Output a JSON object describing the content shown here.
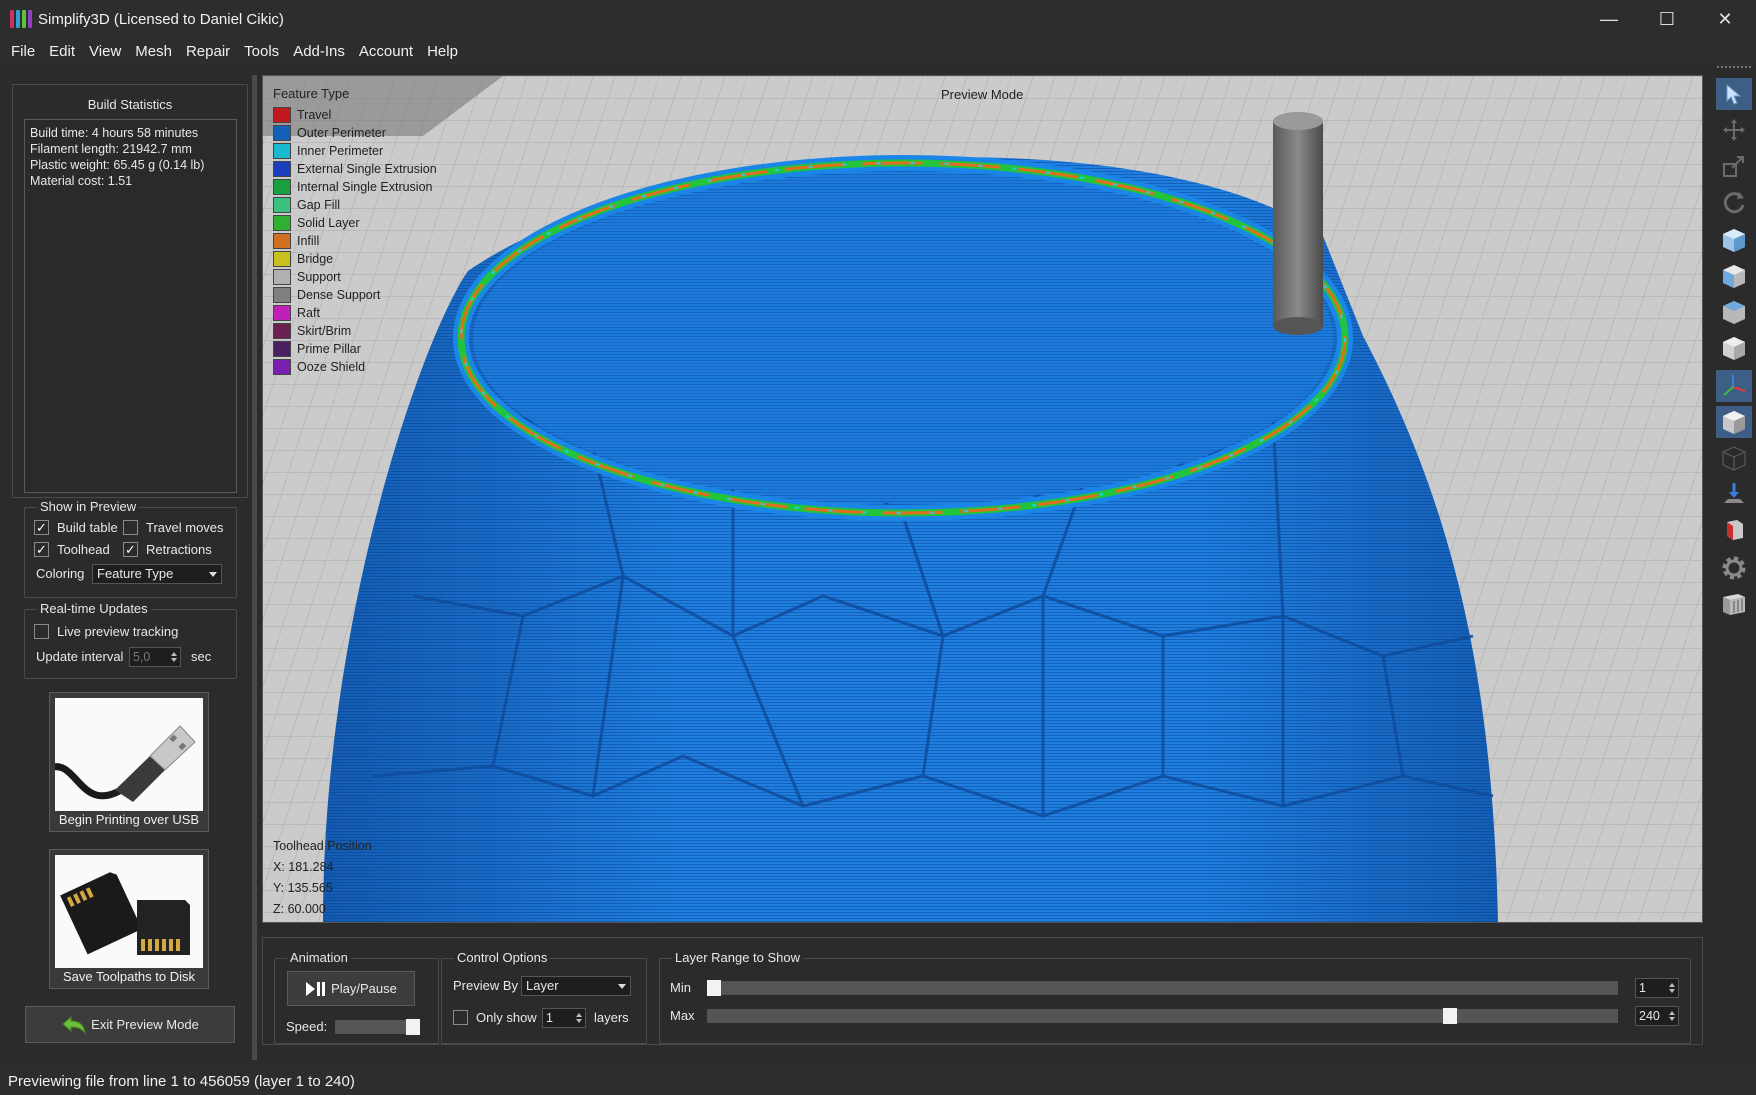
{
  "window": {
    "title": "Simplify3D (Licensed to Daniel Cikic)",
    "minimize": "—",
    "maximize": "☐",
    "close": "✕"
  },
  "menu": [
    "File",
    "Edit",
    "View",
    "Mesh",
    "Repair",
    "Tools",
    "Add-Ins",
    "Account",
    "Help"
  ],
  "build_statistics": {
    "title": "Build Statistics",
    "lines": [
      "Build time: 4 hours 58 minutes",
      "Filament length: 21942.7 mm",
      "Plastic weight: 65.45 g (0.14 lb)",
      "Material cost: 1.51"
    ]
  },
  "show_in_preview": {
    "title": "Show in Preview",
    "build_table": {
      "label": "Build table",
      "checked": true
    },
    "travel_moves": {
      "label": "Travel moves",
      "checked": false
    },
    "toolhead": {
      "label": "Toolhead",
      "checked": true
    },
    "retractions": {
      "label": "Retractions",
      "checked": true
    },
    "coloring_label": "Coloring",
    "coloring_value": "Feature Type"
  },
  "realtime_updates": {
    "title": "Real-time Updates",
    "live_tracking": {
      "label": "Live preview tracking",
      "checked": false
    },
    "interval_label": "Update interval",
    "interval_value": "5,0",
    "interval_unit": "sec"
  },
  "actions": {
    "usb_label": "Begin Printing over USB",
    "disk_label": "Save Toolpaths to Disk",
    "exit_label": "Exit Preview Mode"
  },
  "viewport": {
    "legend_title": "Feature Type",
    "mode_label": "Preview Mode",
    "legend": [
      {
        "label": "Travel",
        "color": "#c0181c"
      },
      {
        "label": "Outer Perimeter",
        "color": "#1560b8"
      },
      {
        "label": "Inner Perimeter",
        "color": "#18b8d0"
      },
      {
        "label": "External Single Extrusion",
        "color": "#1a40c0"
      },
      {
        "label": "Internal Single Extrusion",
        "color": "#18a040"
      },
      {
        "label": "Gap Fill",
        "color": "#3cc080"
      },
      {
        "label": "Solid Layer",
        "color": "#30b030"
      },
      {
        "label": "Infill",
        "color": "#d07020"
      },
      {
        "label": "Bridge",
        "color": "#c8c020"
      },
      {
        "label": "Support",
        "color": "#b0b0b0"
      },
      {
        "label": "Dense Support",
        "color": "#808080"
      },
      {
        "label": "Raft",
        "color": "#c020b8"
      },
      {
        "label": "Skirt/Brim",
        "color": "#6a2050"
      },
      {
        "label": "Prime Pillar",
        "color": "#4a2060"
      },
      {
        "label": "Ooze Shield",
        "color": "#7a20b0"
      }
    ],
    "toolhead_title": "Toolhead Position",
    "toolhead_x": "X: 181.284",
    "toolhead_y": "Y: 135.565",
    "toolhead_z": "Z: 60.000"
  },
  "toolbar_icons": [
    "select-icon",
    "move-icon",
    "scale-icon",
    "rotate-icon",
    "view-default-icon",
    "view-front-icon",
    "view-top-icon",
    "view-side-icon",
    "axes-icon",
    "solid-view-icon",
    "wireframe-view-icon",
    "drop-to-table-icon",
    "cross-section-icon",
    "settings-gear-icon",
    "build-table-icon"
  ],
  "animation": {
    "title": "Animation",
    "play_label": "Play/Pause",
    "speed_label": "Speed:"
  },
  "control_options": {
    "title": "Control Options",
    "preview_by_label": "Preview By",
    "preview_by_value": "Layer",
    "only_show_label": "Only show",
    "only_show_value": "1",
    "layers_label": "layers"
  },
  "layer_range": {
    "title": "Layer Range to Show",
    "min_label": "Min",
    "max_label": "Max",
    "min_value": "1",
    "max_value": "240",
    "min_position": 0.0,
    "max_position": 0.82
  },
  "status": "Previewing file from line 1 to 456059 (layer 1 to 240)"
}
